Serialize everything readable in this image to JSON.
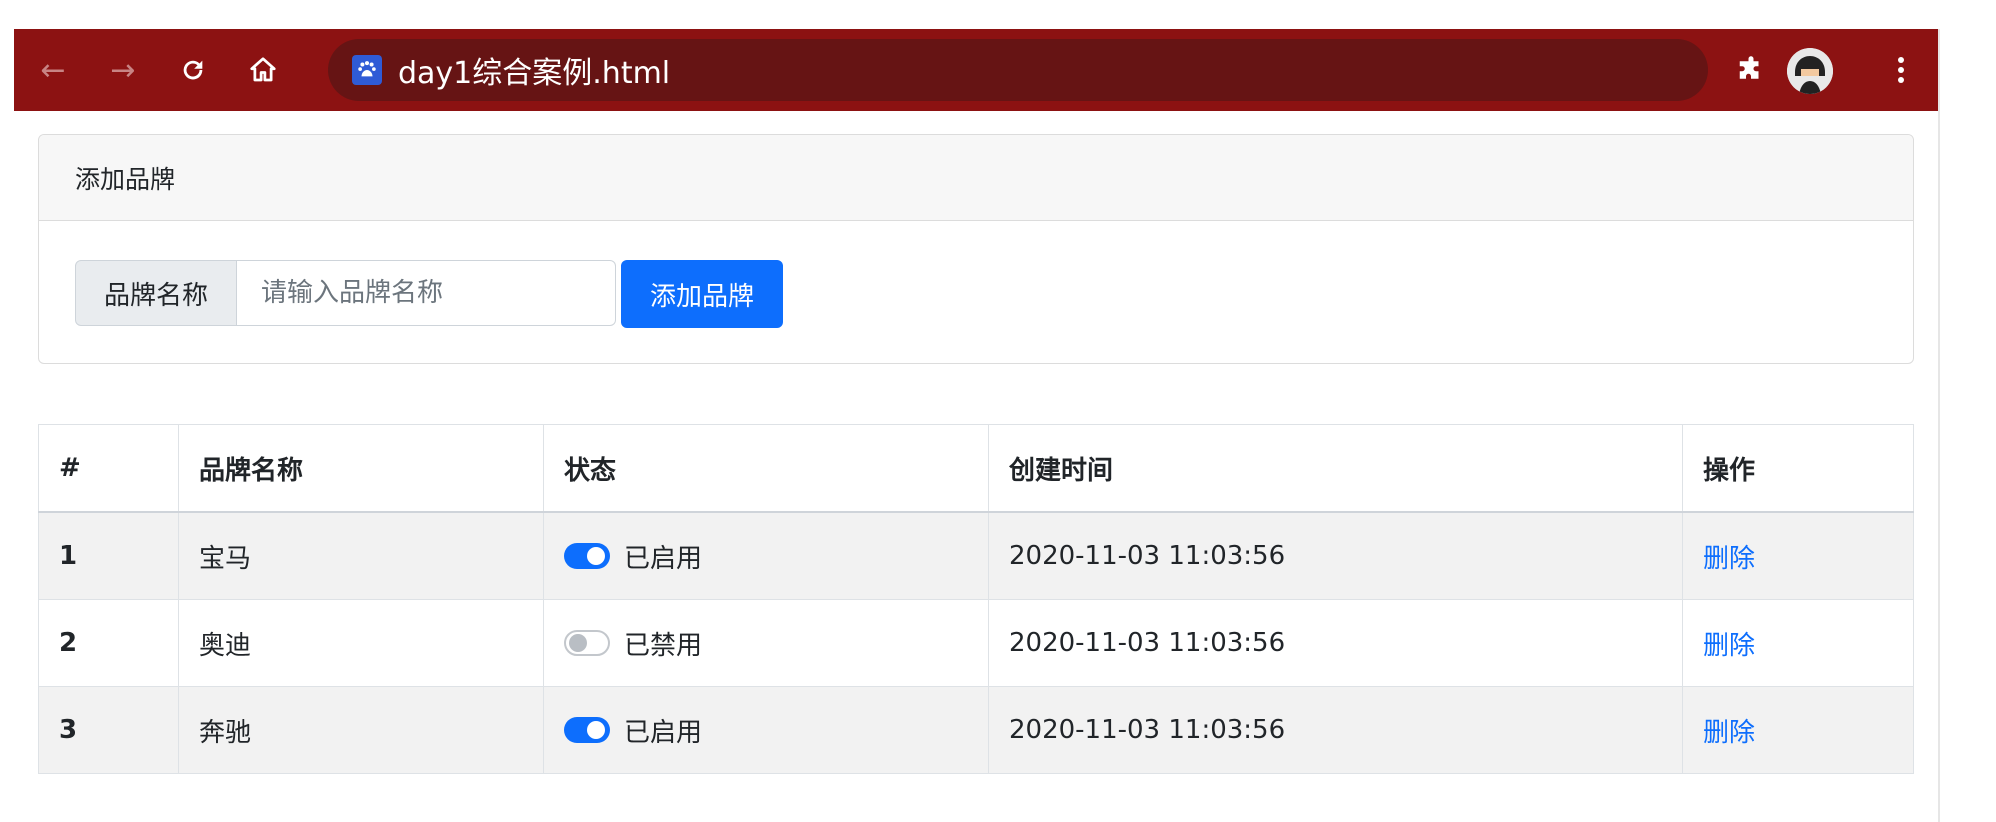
{
  "browser": {
    "url": "day1综合案例.html",
    "icons": [
      "back-icon",
      "forward-icon",
      "reload-icon",
      "home-icon",
      "extensions-icon",
      "avatar",
      "menu-icon"
    ]
  },
  "card": {
    "header": "添加品牌",
    "input_label": "品牌名称",
    "input_placeholder": "请输入品牌名称",
    "input_value": "",
    "button_label": "添加品牌"
  },
  "table": {
    "headers": [
      "#",
      "品牌名称",
      "状态",
      "创建时间",
      "操作"
    ],
    "rows": [
      {
        "index": "1",
        "name": "宝马",
        "enabled": true,
        "status": "已启用",
        "created": "2020-11-03 11:03:56",
        "action": "删除"
      },
      {
        "index": "2",
        "name": "奥迪",
        "enabled": false,
        "status": "已禁用",
        "created": "2020-11-03 11:03:56",
        "action": "删除"
      },
      {
        "index": "3",
        "name": "奔驰",
        "enabled": true,
        "status": "已启用",
        "created": "2020-11-03 11:03:56",
        "action": "删除"
      }
    ]
  },
  "colors": {
    "toolbar": "#8c1212",
    "omnibox": "#661414",
    "primary": "#0d6efd"
  }
}
